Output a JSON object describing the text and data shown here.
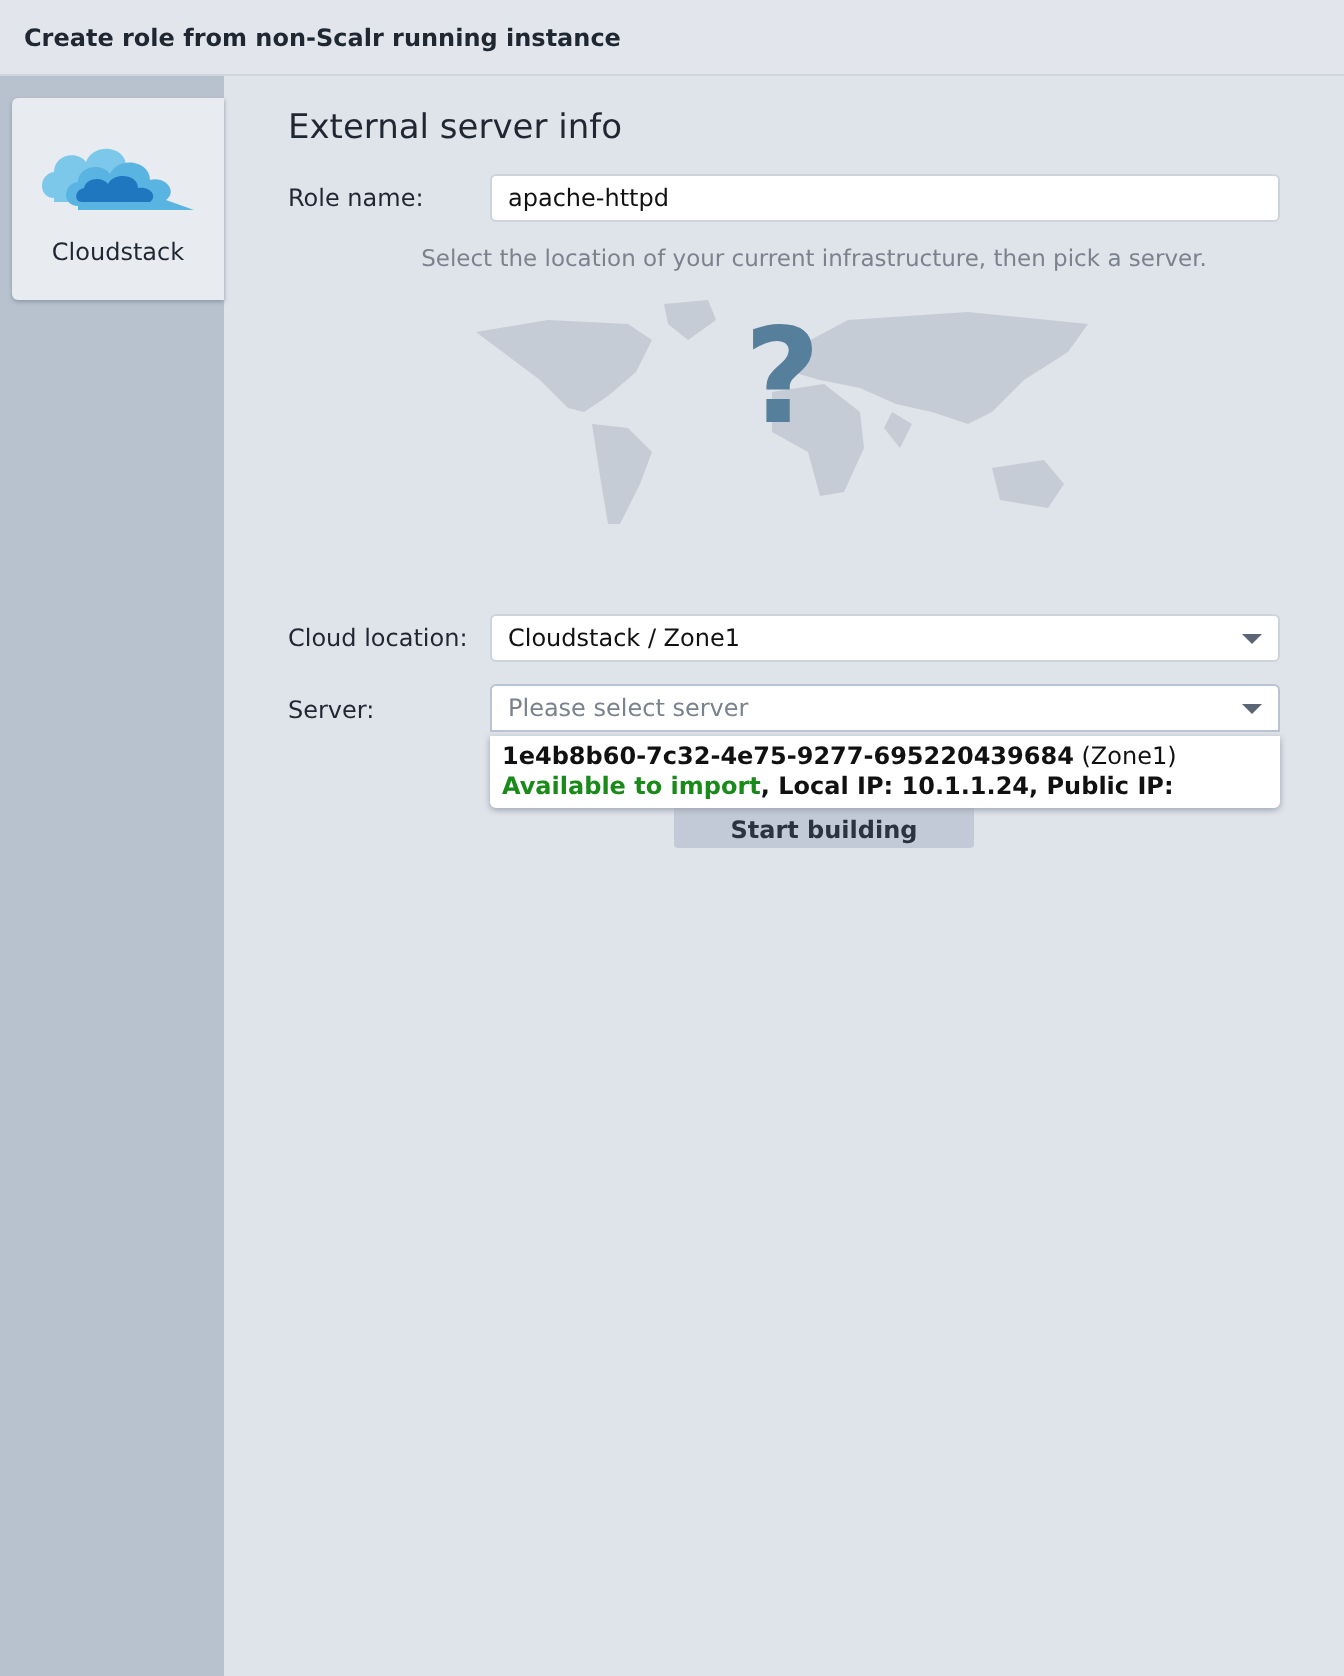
{
  "window": {
    "title": "Create role from non-Scalr running instance"
  },
  "sidebar": {
    "items": [
      {
        "label": "Cloudstack",
        "selected": true
      }
    ]
  },
  "form": {
    "heading": "External server info",
    "role_name": {
      "label": "Role name:",
      "value": "apache-httpd"
    },
    "hint": "Select the location of your current infrastructure, then pick a server.",
    "map_overlay": "?",
    "cloud_location": {
      "label": "Cloud location:",
      "value": "Cloudstack / Zone1"
    },
    "server": {
      "label": "Server:",
      "placeholder": "Please select server",
      "expanded": true,
      "options": [
        {
          "id": "1e4b8b60-7c32-4e75-9277-695220439684",
          "zone": "(Zone1)",
          "status": "Available to import",
          "details": ", Local IP: 10.1.1.24, Public IP:"
        }
      ]
    },
    "button": "Start building"
  }
}
